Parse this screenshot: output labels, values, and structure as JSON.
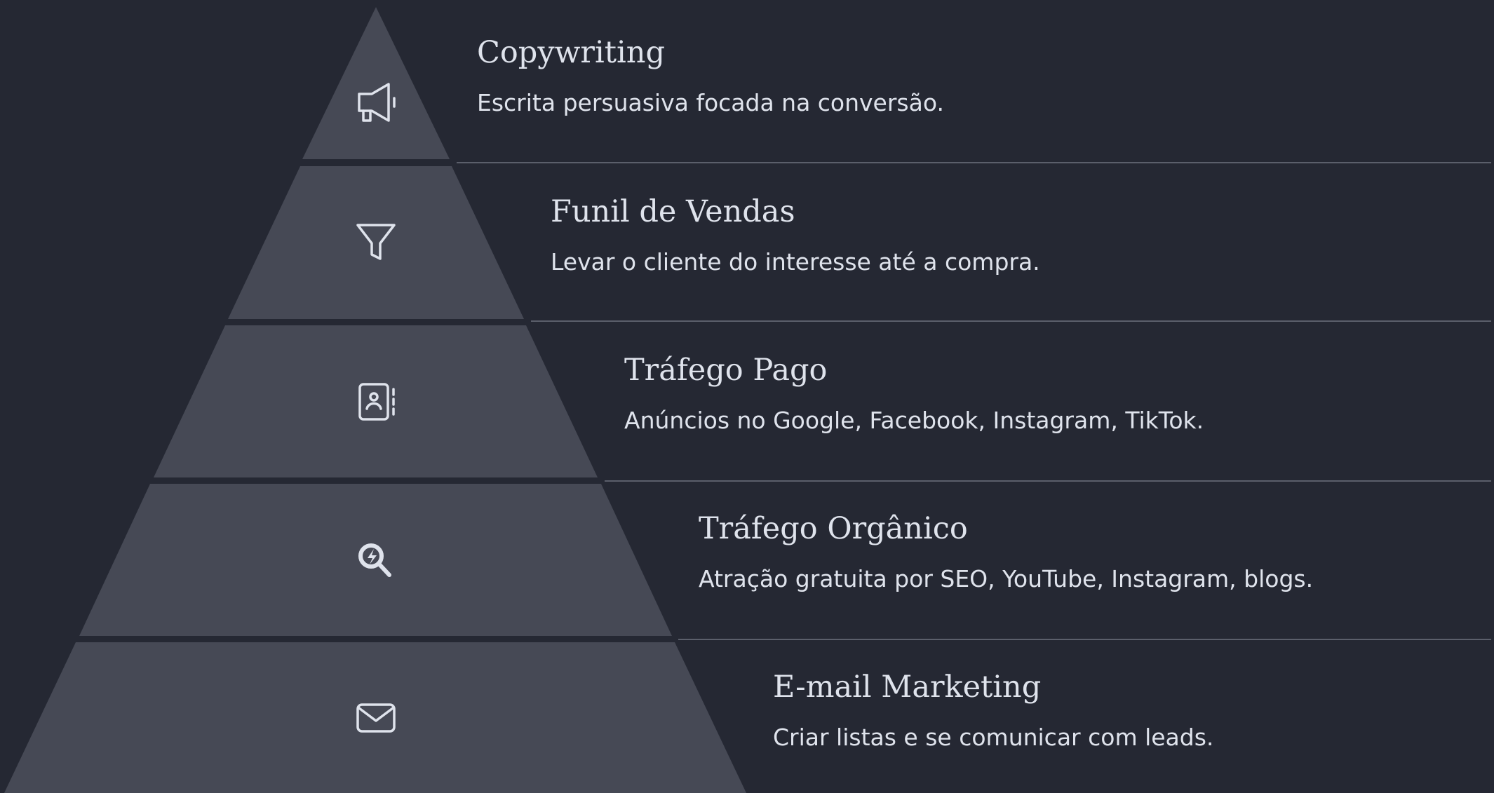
{
  "colors": {
    "background": "#252833",
    "tier_fill": "#464955",
    "text": "#dfe3ec",
    "divider": "#5b5f6b"
  },
  "tiers": [
    {
      "title": "Copywriting",
      "description": "Escrita persuasiva focada na conversão.",
      "icon": "megaphone-icon"
    },
    {
      "title": "Funil de Vendas",
      "description": "Levar o cliente do interesse até a compra.",
      "icon": "funnel-icon"
    },
    {
      "title": "Tráfego Pago",
      "description": "Anúncios no Google, Facebook, Instagram, TikTok.",
      "icon": "contact-book-icon"
    },
    {
      "title": "Tráfego Orgânico",
      "description": "Atração gratuita por SEO, YouTube, Instagram, blogs.",
      "icon": "search-bolt-icon"
    },
    {
      "title": "E-mail Marketing",
      "description": "Criar listas e se comunicar com leads.",
      "icon": "envelope-icon"
    }
  ]
}
